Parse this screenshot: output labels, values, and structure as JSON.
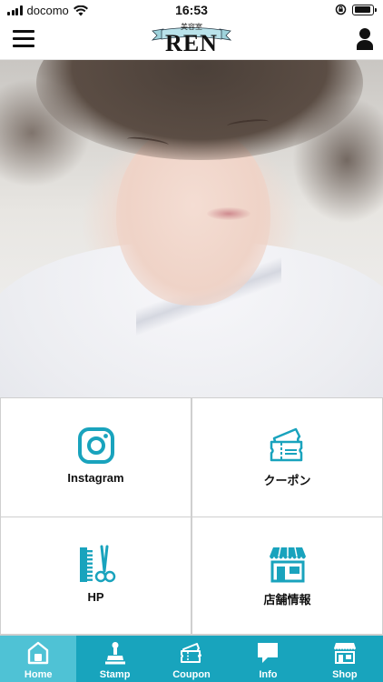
{
  "status_bar": {
    "carrier": "docomo",
    "time": "16:53",
    "battery_level": 0.9
  },
  "header": {
    "logo_subtitle": "美容室",
    "logo_title": "REN"
  },
  "colors": {
    "accent": "#18a4bd",
    "tab_active": "#4fc2d5",
    "icon": "#19a3bd"
  },
  "menu": [
    {
      "label": "Instagram",
      "icon": "instagram-icon"
    },
    {
      "label": "クーポン",
      "icon": "coupon-icon"
    },
    {
      "label": "HP",
      "icon": "comb-scissors-icon"
    },
    {
      "label": "店舗情報",
      "icon": "store-icon"
    }
  ],
  "tabs": [
    {
      "label": "Home",
      "icon": "home-icon",
      "active": true
    },
    {
      "label": "Stamp",
      "icon": "stamp-icon",
      "active": false
    },
    {
      "label": "Coupon",
      "icon": "coupon-icon",
      "active": false
    },
    {
      "label": "Info",
      "icon": "info-chat-icon",
      "active": false
    },
    {
      "label": "Shop",
      "icon": "shop-icon",
      "active": false
    }
  ]
}
